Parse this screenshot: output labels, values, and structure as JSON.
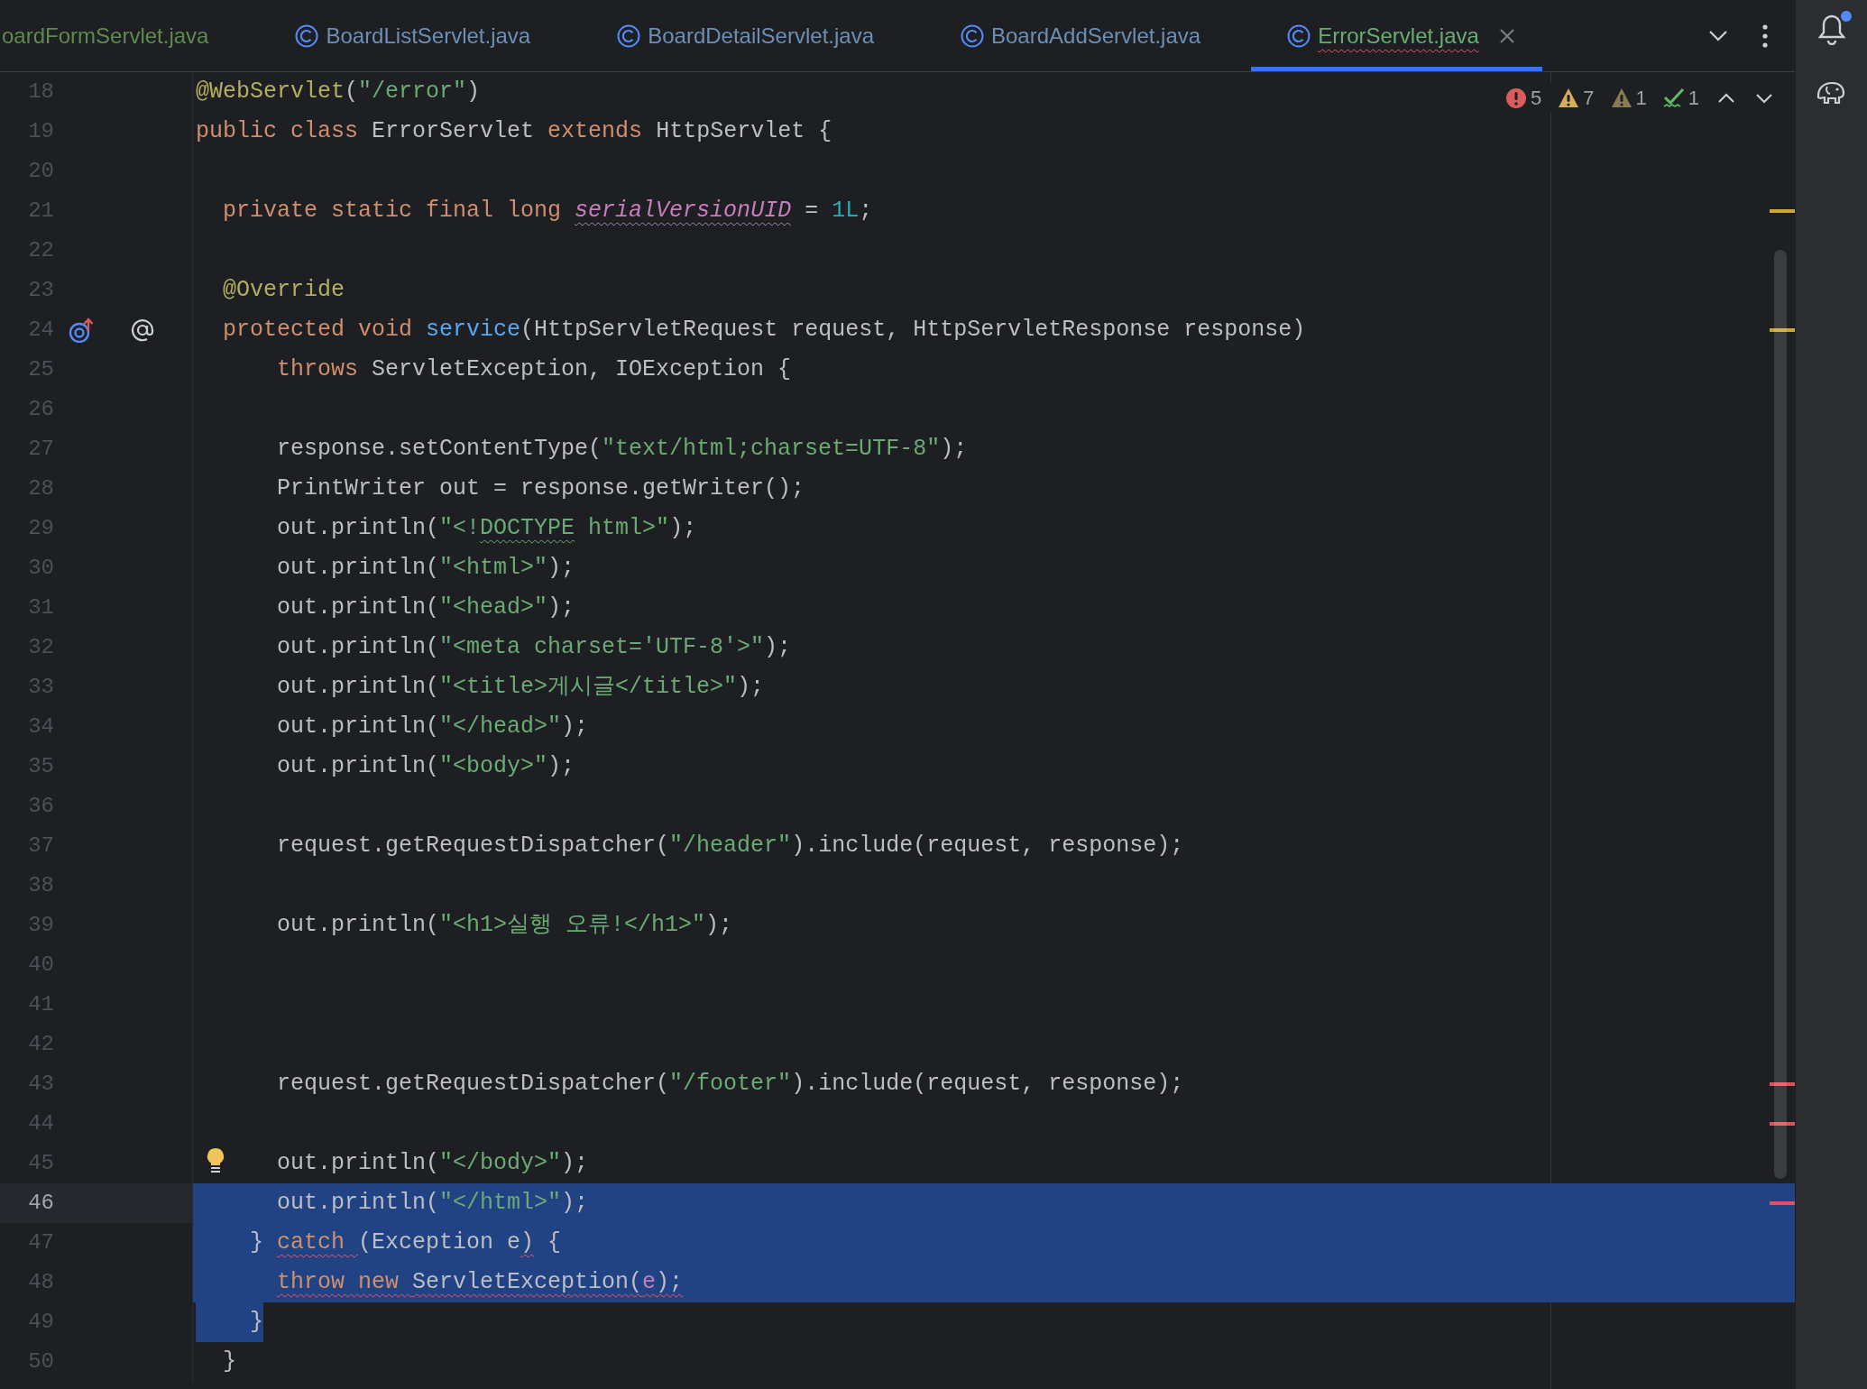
{
  "tabs": [
    {
      "label": "oardFormServlet.java",
      "icon": false,
      "color": "#5e8a50",
      "error": false,
      "selected": false
    },
    {
      "label": "BoardListServlet.java",
      "icon": true,
      "color": "#6b8fb5",
      "error": false,
      "selected": false
    },
    {
      "label": "BoardDetailServlet.java",
      "icon": true,
      "color": "#6b8fb5",
      "error": false,
      "selected": false
    },
    {
      "label": "BoardAddServlet.java",
      "icon": true,
      "color": "#6b8fb5",
      "error": false,
      "selected": false
    },
    {
      "label": "ErrorServlet.java",
      "icon": true,
      "color": "#6aab73",
      "error": true,
      "selected": true
    }
  ],
  "inspections": [
    {
      "kind": "error",
      "count": "5"
    },
    {
      "kind": "warning",
      "count": "7"
    },
    {
      "kind": "weak",
      "count": "1"
    },
    {
      "kind": "typo",
      "count": "1"
    }
  ],
  "sidebar": {
    "notification_dot": true
  },
  "lines": [
    {
      "number": "18",
      "current": false,
      "selected": false,
      "code": [
        {
          "kind": "annotation",
          "text": "@WebServlet"
        },
        {
          "kind": "plain",
          "text": "("
        },
        {
          "kind": "string",
          "text": "\"/error\""
        },
        {
          "kind": "plain",
          "text": ")"
        }
      ]
    },
    {
      "number": "19",
      "current": false,
      "selected": false,
      "code": [
        {
          "kind": "keyword",
          "text": "public class "
        },
        {
          "kind": "plain",
          "text": "ErrorServlet "
        },
        {
          "kind": "keyword",
          "text": "extends "
        },
        {
          "kind": "plain",
          "text": "HttpServlet {"
        }
      ]
    },
    {
      "number": "20",
      "current": false,
      "selected": false
    },
    {
      "number": "21",
      "current": false,
      "selected": false,
      "warning_marker": true,
      "code": [
        {
          "kind": "keyword",
          "text": "  private static final long "
        },
        {
          "kind": "field",
          "text": "serialVersionUID",
          "weak_squiggle": true
        },
        {
          "kind": "plain",
          "text": " = "
        },
        {
          "kind": "number",
          "text": "1L"
        },
        {
          "kind": "plain",
          "text": ";"
        }
      ]
    },
    {
      "number": "22",
      "current": false,
      "selected": false
    },
    {
      "number": "23",
      "current": false,
      "selected": false,
      "code": [
        {
          "kind": "annotation",
          "text": "  @Override"
        }
      ]
    },
    {
      "number": "24",
      "current": false,
      "selected": false,
      "warning_marker": true,
      "gutter_icons": [
        {
          "kind": "override"
        },
        {
          "kind": "annotation"
        }
      ],
      "code": [
        {
          "kind": "keyword",
          "text": "  protected void "
        },
        {
          "kind": "method",
          "text": "service"
        },
        {
          "kind": "plain",
          "text": "(HttpServletRequest request, HttpServletResponse response)"
        }
      ]
    },
    {
      "number": "25",
      "current": false,
      "selected": false,
      "code": [
        {
          "kind": "keyword",
          "text": "      throws "
        },
        {
          "kind": "plain",
          "text": "ServletException, IOException {"
        }
      ]
    },
    {
      "number": "26",
      "current": false,
      "selected": false
    },
    {
      "number": "27",
      "current": false,
      "selected": false,
      "code": [
        {
          "kind": "plain",
          "text": "      response.setContentType("
        },
        {
          "kind": "string",
          "text": "\"text/html;charset=UTF-8\""
        },
        {
          "kind": "plain",
          "text": ");"
        }
      ]
    },
    {
      "number": "28",
      "current": false,
      "selected": false,
      "code": [
        {
          "kind": "plain",
          "text": "      PrintWriter out = response.getWriter();"
        }
      ]
    },
    {
      "number": "29",
      "current": false,
      "selected": false,
      "code": [
        {
          "kind": "plain",
          "text": "      out.println("
        },
        {
          "kind": "string",
          "text": "\"<!"
        },
        {
          "kind": "string",
          "text": "DOCTYPE",
          "typo_squiggle": true
        },
        {
          "kind": "string",
          "text": " html>\""
        },
        {
          "kind": "plain",
          "text": ");"
        }
      ]
    },
    {
      "number": "30",
      "current": false,
      "selected": false,
      "code": [
        {
          "kind": "plain",
          "text": "      out.println("
        },
        {
          "kind": "string",
          "text": "\"<html>\""
        },
        {
          "kind": "plain",
          "text": ");"
        }
      ]
    },
    {
      "number": "31",
      "current": false,
      "selected": false,
      "code": [
        {
          "kind": "plain",
          "text": "      out.println("
        },
        {
          "kind": "string",
          "text": "\"<head>\""
        },
        {
          "kind": "plain",
          "text": ");"
        }
      ]
    },
    {
      "number": "32",
      "current": false,
      "selected": false,
      "code": [
        {
          "kind": "plain",
          "text": "      out.println("
        },
        {
          "kind": "string",
          "text": "\"<meta charset='UTF-8'>\""
        },
        {
          "kind": "plain",
          "text": ");"
        }
      ]
    },
    {
      "number": "33",
      "current": false,
      "selected": false,
      "code": [
        {
          "kind": "plain",
          "text": "      out.println("
        },
        {
          "kind": "string",
          "text": "\"<title>게시글</title>\""
        },
        {
          "kind": "plain",
          "text": ");"
        }
      ]
    },
    {
      "number": "34",
      "current": false,
      "selected": false,
      "code": [
        {
          "kind": "plain",
          "text": "      out.println("
        },
        {
          "kind": "string",
          "text": "\"</head>\""
        },
        {
          "kind": "plain",
          "text": ");"
        }
      ]
    },
    {
      "number": "35",
      "current": false,
      "selected": false,
      "code": [
        {
          "kind": "plain",
          "text": "      out.println("
        },
        {
          "kind": "string",
          "text": "\"<body>\""
        },
        {
          "kind": "plain",
          "text": ");"
        }
      ]
    },
    {
      "number": "36",
      "current": false,
      "selected": false
    },
    {
      "number": "37",
      "current": false,
      "selected": false,
      "code": [
        {
          "kind": "plain",
          "text": "      request.getRequestDispatcher("
        },
        {
          "kind": "string",
          "text": "\"/header\""
        },
        {
          "kind": "plain",
          "text": ").include(request, response);"
        }
      ]
    },
    {
      "number": "38",
      "current": false,
      "selected": false
    },
    {
      "number": "39",
      "current": false,
      "selected": false,
      "code": [
        {
          "kind": "plain",
          "text": "      out.println("
        },
        {
          "kind": "string",
          "text": "\"<h1>실행 오류!</h1>\""
        },
        {
          "kind": "plain",
          "text": ");"
        }
      ]
    },
    {
      "number": "40",
      "current": false,
      "selected": false
    },
    {
      "number": "41",
      "current": false,
      "selected": false
    },
    {
      "number": "42",
      "current": false,
      "selected": false
    },
    {
      "number": "43",
      "current": false,
      "selected": false,
      "error_marker": true,
      "code": [
        {
          "kind": "plain",
          "text": "      request.getRequestDispatcher("
        },
        {
          "kind": "string",
          "text": "\"/footer\""
        },
        {
          "kind": "plain",
          "text": ").include(request, response);"
        }
      ]
    },
    {
      "number": "44",
      "current": false,
      "selected": false,
      "error_marker": true
    },
    {
      "number": "45",
      "current": false,
      "selected": false,
      "intention_bulb": true,
      "code": [
        {
          "kind": "plain",
          "text": "      out.println("
        },
        {
          "kind": "string",
          "text": "\"</body>\""
        },
        {
          "kind": "plain",
          "text": ");"
        }
      ]
    },
    {
      "number": "46",
      "current": true,
      "selected": true,
      "selection_after_text": true,
      "error_marker": true,
      "code": [
        {
          "kind": "plain",
          "text": "      out.println("
        },
        {
          "kind": "string",
          "text": "\"</html>\""
        },
        {
          "kind": "plain",
          "text": ");"
        }
      ]
    },
    {
      "number": "47",
      "current": false,
      "selected": true,
      "code": [
        {
          "kind": "plain",
          "text": "    } "
        },
        {
          "kind": "keyword",
          "text": "catch ",
          "error_squiggle": true
        },
        {
          "kind": "plain",
          "text": "(Exception e"
        },
        {
          "kind": "plain",
          "text": ")",
          "error_squiggle": true
        },
        {
          "kind": "plain",
          "text": " {"
        }
      ]
    },
    {
      "number": "48",
      "current": false,
      "selected": true,
      "code": [
        {
          "kind": "keyword",
          "text": "      throw new ",
          "error_squiggle": true
        },
        {
          "kind": "plain",
          "text": "ServletException(",
          "error_squiggle": true
        },
        {
          "kind": "param",
          "text": "e",
          "error_squiggle": true
        },
        {
          "kind": "plain",
          "text": ");",
          "error_squiggle": true
        }
      ]
    },
    {
      "number": "49",
      "current": false,
      "selected": true,
      "selection_to_text_end": true,
      "code": [
        {
          "kind": "plain",
          "text": "    }"
        }
      ]
    },
    {
      "number": "50",
      "current": false,
      "selected": false,
      "code": [
        {
          "kind": "plain",
          "text": "  }"
        }
      ]
    }
  ]
}
